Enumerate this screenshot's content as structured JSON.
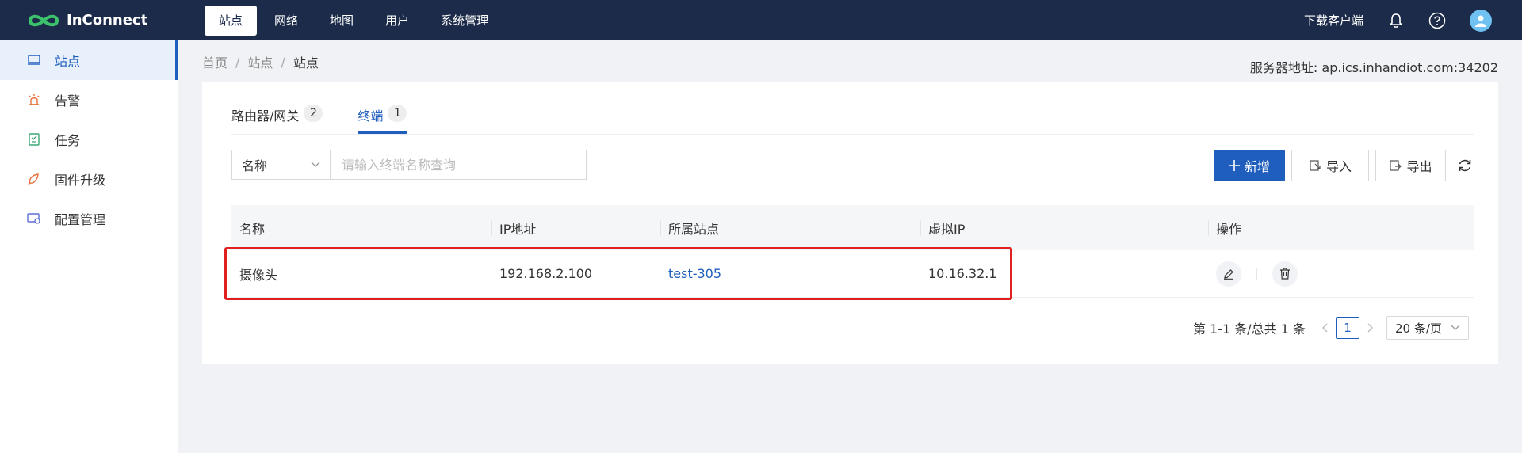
{
  "brand": {
    "name": "InConnect"
  },
  "topnav": {
    "items": [
      {
        "label": "站点",
        "active": true
      },
      {
        "label": "网络"
      },
      {
        "label": "地图"
      },
      {
        "label": "用户"
      },
      {
        "label": "系统管理"
      }
    ],
    "download_label": "下载客户端"
  },
  "sidebar": {
    "items": [
      {
        "label": "站点",
        "icon": "site-icon"
      },
      {
        "label": "告警",
        "icon": "alarm-icon"
      },
      {
        "label": "任务",
        "icon": "task-icon"
      },
      {
        "label": "固件升级",
        "icon": "firmware-icon"
      },
      {
        "label": "配置管理",
        "icon": "config-icon"
      }
    ]
  },
  "breadcrumb": [
    "首页",
    "站点",
    "站点"
  ],
  "server": {
    "label": "服务器地址: ap.ics.inhandiot.com:34202"
  },
  "tabs": [
    {
      "label": "路由器/网关",
      "count": "2"
    },
    {
      "label": "终端",
      "count": "1"
    }
  ],
  "filter": {
    "field": "名称",
    "placeholder": "请输入终端名称查询"
  },
  "actions": {
    "add": "新增",
    "import": "导入",
    "export": "导出"
  },
  "table": {
    "columns": [
      "名称",
      "IP地址",
      "所属站点",
      "虚拟IP",
      "操作"
    ],
    "rows": [
      {
        "name": "摄像头",
        "ip": "192.168.2.100",
        "site": "test-305",
        "vip": "10.16.32.1"
      }
    ]
  },
  "pagination": {
    "total": "第 1-1 条/总共 1 条",
    "current": "1",
    "page_size": "20 条/页"
  },
  "colors": {
    "topbar": "#1c2b4a",
    "primary": "#1f5ebd",
    "highlight": "#e02020"
  }
}
